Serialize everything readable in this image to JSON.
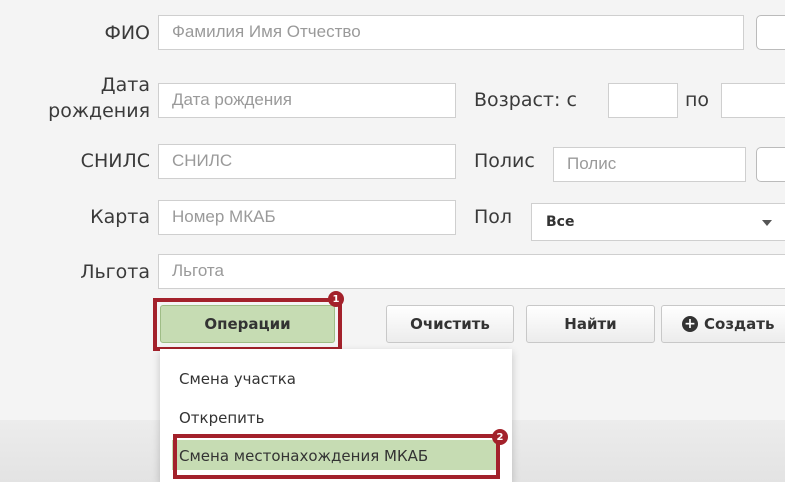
{
  "form": {
    "fio": {
      "label": "ФИО",
      "placeholder": "Фамилия Имя Отчество"
    },
    "birth": {
      "label_line1": "Дата",
      "label_line2": "рождения",
      "placeholder": "Дата рождения"
    },
    "age": {
      "label": "Возраст:",
      "from_label": "с",
      "to_label": "по"
    },
    "snils": {
      "label": "СНИЛС",
      "placeholder": "СНИЛС"
    },
    "polis": {
      "label": "Полис",
      "placeholder": "Полис"
    },
    "card": {
      "label": "Карта",
      "placeholder": "Номер МКАБ"
    },
    "sex": {
      "label": "Пол",
      "selected": "Все"
    },
    "benefit": {
      "label": "Льгота",
      "placeholder": "Льгота"
    }
  },
  "buttons": {
    "operations": "Операции",
    "clear": "Очистить",
    "find": "Найти",
    "create": "Создать"
  },
  "markers": {
    "first": "1",
    "second": "2"
  },
  "menu": {
    "items": [
      "Смена участка",
      "Открепить",
      "Смена местонахождения МКАБ"
    ]
  },
  "colors": {
    "highlight": "#a3212b",
    "active_fill": "#c6dcb3"
  }
}
